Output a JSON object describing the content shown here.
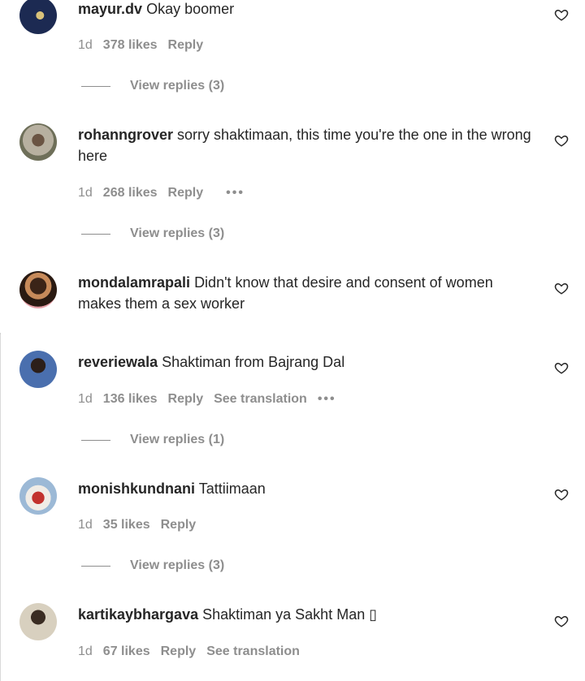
{
  "comments": [
    {
      "username": "mayur.dv",
      "text": "Okay boomer",
      "time": "1d",
      "likes": "378 likes",
      "reply": "Reply",
      "extra": "",
      "dots": false,
      "view_replies": "View replies (3)"
    },
    {
      "username": "rohanngrover",
      "text": "sorry shaktimaan, this time you're the one in the wrong here",
      "time": "1d",
      "likes": "268 likes",
      "reply": "Reply",
      "extra": "",
      "dots": true,
      "view_replies": "View replies (3)"
    },
    {
      "username": "mondalamrapali",
      "text": "Didn't know that desire and consent of women makes them a sex worker",
      "time": "",
      "likes": "",
      "reply": "",
      "extra": "",
      "dots": false,
      "view_replies": ""
    },
    {
      "username": "reveriewala",
      "text": "Shaktiman from Bajrang Dal",
      "time": "1d",
      "likes": "136 likes",
      "reply": "Reply",
      "extra": "See translation",
      "dots": true,
      "view_replies": "View replies (1)"
    },
    {
      "username": "monishkundnani",
      "text": "Tattiimaan",
      "time": "1d",
      "likes": "35 likes",
      "reply": "Reply",
      "extra": "",
      "dots": false,
      "view_replies": "View replies (3)"
    },
    {
      "username": "kartikaybhargava",
      "text": "Shaktiman ya Sakht Man ▯",
      "time": "1d",
      "likes": "67 likes",
      "reply": "Reply",
      "extra": "See translation",
      "dots": false,
      "view_replies": ""
    }
  ],
  "icons": {
    "heart": "heart-outline-icon",
    "more": "more-dots-icon"
  }
}
